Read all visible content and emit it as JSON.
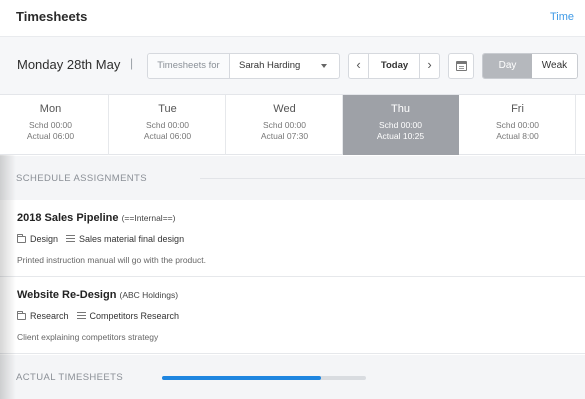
{
  "header": {
    "title": "Timesheets",
    "link": "Time"
  },
  "toolbar": {
    "date": "Monday 28th May",
    "separator": "|",
    "timesheets_for_label": "Timesheets for",
    "timesheets_for_value": "Sarah Harding",
    "prev": "‹",
    "today": "Today",
    "next": "›",
    "view_day": "Day",
    "view_week": "Weak"
  },
  "days": [
    {
      "name": "Mon",
      "schd": "Schd 00:00",
      "actual": "Actual 06:00",
      "active": false
    },
    {
      "name": "Tue",
      "schd": "Schd 00:00",
      "actual": "Actual 06:00",
      "active": false
    },
    {
      "name": "Wed",
      "schd": "Schd 00:00",
      "actual": "Actual 07:30",
      "active": false
    },
    {
      "name": "Thu",
      "schd": "Schd 00:00",
      "actual": "Actual 10:25",
      "active": true
    },
    {
      "name": "Fri",
      "schd": "Schd 00:00",
      "actual": "Actual 8:00",
      "active": false
    }
  ],
  "schedule": {
    "title": "SCHEDULE ASSIGNMENTS",
    "items": [
      {
        "project": "2018 Sales Pipeline",
        "client": "(==Internal==)",
        "category": "Design",
        "task": "Sales material final design",
        "description": "Printed instruction manual will go with the product."
      },
      {
        "project": "Website Re-Design",
        "client": "(ABC Holdings)",
        "category": "Research",
        "task": "Competitors Research",
        "description": "Client explaining competitors strategy"
      }
    ]
  },
  "actual": {
    "title": "ACTUAL TIMESHEETS",
    "progress": 0.78
  },
  "colors": {
    "accent": "#1f86e0",
    "link": "#3f9ae6",
    "active_day": "#9ea1a7"
  }
}
